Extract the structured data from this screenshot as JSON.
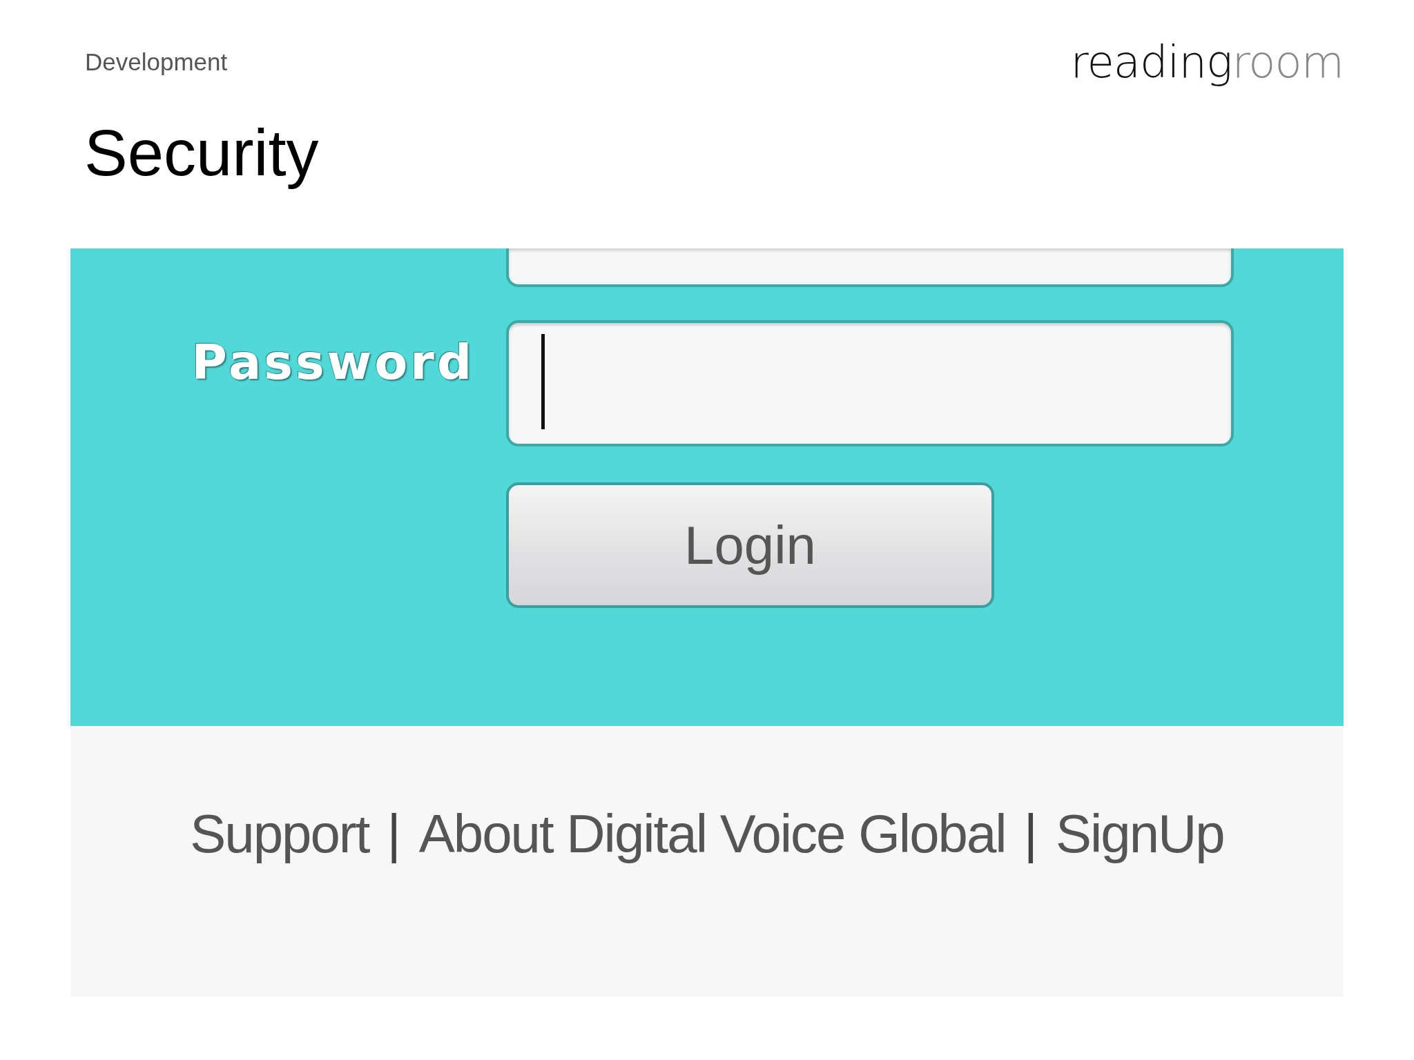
{
  "header": {
    "section": "Development",
    "logo": {
      "dark": "reading",
      "light": "room"
    }
  },
  "title": "Security",
  "login": {
    "fields": [
      {
        "kind": "cut"
      },
      {
        "kind": "labeled",
        "label": "Password",
        "focused": true
      }
    ],
    "button": "Login"
  },
  "footer": {
    "items": [
      {
        "kind": "link",
        "text": "Support"
      },
      {
        "kind": "separator",
        "text": "|"
      },
      {
        "kind": "link",
        "text": "About Digital Voice Global"
      },
      {
        "kind": "separator",
        "text": "|"
      },
      {
        "kind": "link",
        "text": "SignUp"
      }
    ]
  }
}
